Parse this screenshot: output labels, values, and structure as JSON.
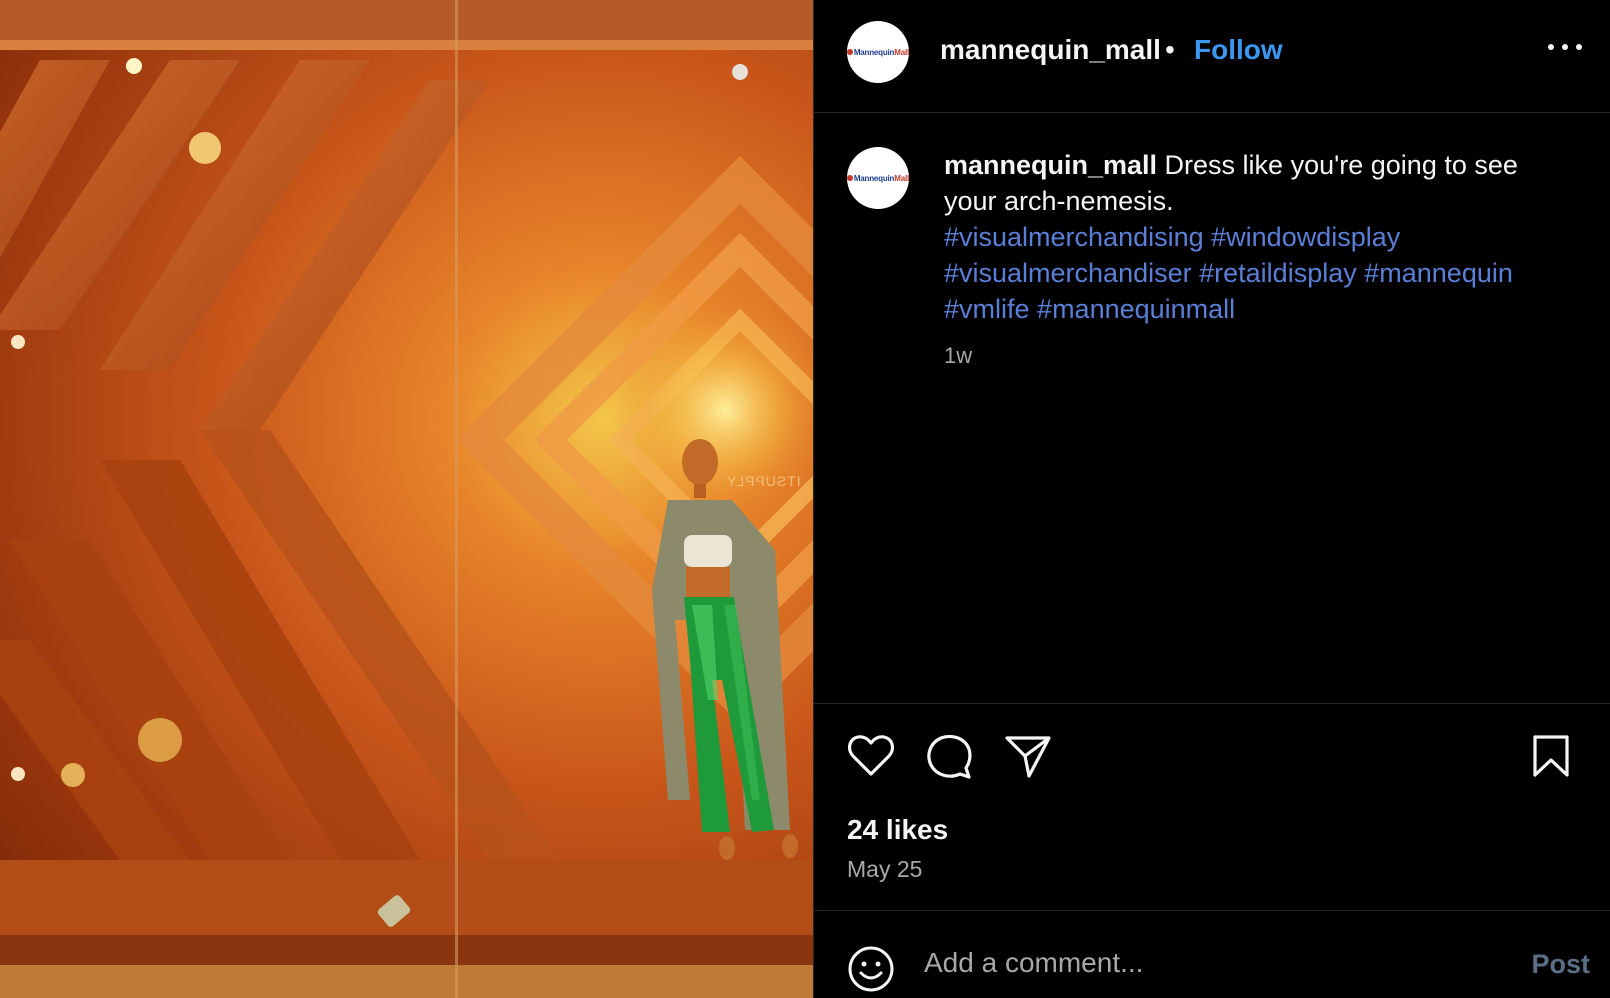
{
  "post": {
    "username": "mannequin_mall",
    "separator": "•",
    "follow_label": "Follow",
    "avatar_text_left": "Mannequin",
    "avatar_text_right": "Mall"
  },
  "caption": {
    "username": "mannequin_mall",
    "text": " Dress like you're going to see your arch-nemesis.",
    "hashtags": [
      "#visualmerchandising",
      "#windowdisplay",
      "#visualmerchandiser",
      "#retaildisplay",
      "#mannequin",
      "#vmlife",
      "#mannequinmall"
    ],
    "age": "1w"
  },
  "photo": {
    "sign_text": "ITSUPPLY"
  },
  "actions": {
    "likes": "24 likes",
    "date": "May 25"
  },
  "comment": {
    "placeholder": "Add a comment...",
    "post_label": "Post"
  },
  "icons": [
    "like-icon",
    "comment-icon",
    "share-icon",
    "save-icon",
    "more-icon",
    "emoji-icon"
  ],
  "colors": {
    "accent": "#3b97f0",
    "hashtag": "#5b7fd6",
    "post_disabled": "#5a6e86"
  }
}
